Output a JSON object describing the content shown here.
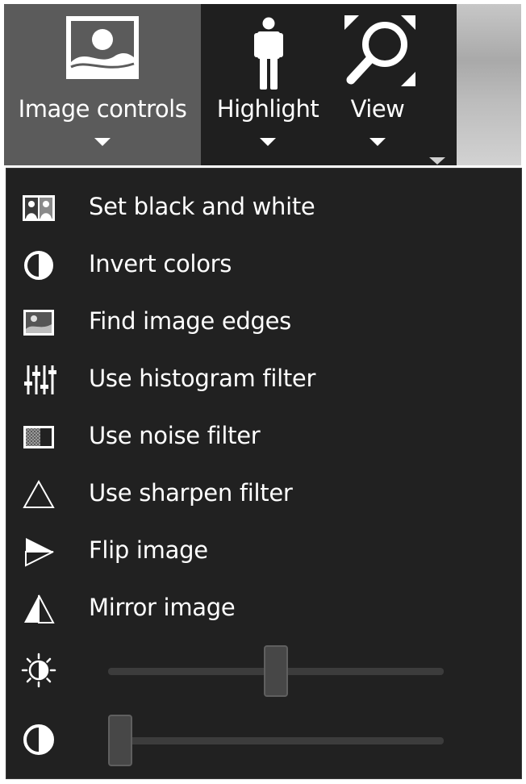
{
  "toolbar": {
    "buttons": [
      {
        "id": "image-controls",
        "label": "Image controls",
        "icon": "image-icon",
        "active": true
      },
      {
        "id": "highlight",
        "label": "Highlight",
        "icon": "person-icon"
      },
      {
        "id": "view",
        "label": "View",
        "icon": "zoom-icon"
      }
    ],
    "overflow_icon": "chevron-down-icon"
  },
  "menu": {
    "items": [
      {
        "label": "Set black and white",
        "icon": "black-white-icon"
      },
      {
        "label": "Invert colors",
        "icon": "invert-icon"
      },
      {
        "label": "Find image edges",
        "icon": "edges-icon"
      },
      {
        "label": "Use histogram filter",
        "icon": "histogram-icon"
      },
      {
        "label": "Use noise filter",
        "icon": "noise-icon"
      },
      {
        "label": "Use sharpen filter",
        "icon": "sharpen-icon"
      },
      {
        "label": "Flip image",
        "icon": "flip-icon"
      },
      {
        "label": "Mirror image",
        "icon": "mirror-icon"
      }
    ],
    "sliders": [
      {
        "id": "brightness",
        "icon": "brightness-icon",
        "value": 0.5
      },
      {
        "id": "contrast",
        "icon": "contrast-icon",
        "value": 0.0
      }
    ]
  },
  "colors": {
    "toolbar_bg": "#1f1f1f",
    "active_button_bg": "#5b5b5b",
    "menu_bg": "#212121",
    "text": "#ffffff"
  }
}
